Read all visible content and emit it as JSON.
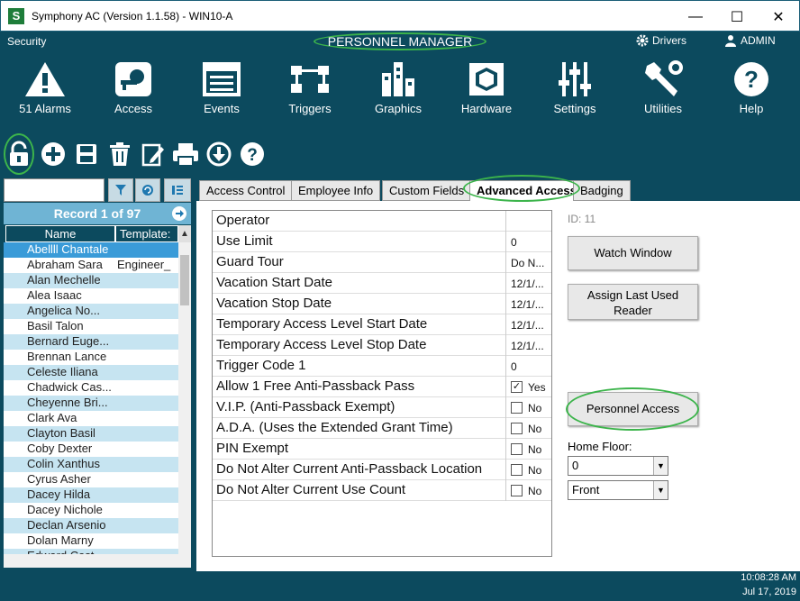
{
  "window": {
    "title": "Symphony AC  (Version 1.1.58) - WIN10-A",
    "logo_letter": "S",
    "minimize": "—",
    "maximize": "☐",
    "close": "✕"
  },
  "header": {
    "section": "Security",
    "module": "PERSONNEL MANAGER",
    "drivers": "Drivers",
    "user": "ADMIN"
  },
  "nav": [
    {
      "label": "51 Alarms",
      "icon": "alarm-icon"
    },
    {
      "label": "Access",
      "icon": "access-icon"
    },
    {
      "label": "Events",
      "icon": "events-icon"
    },
    {
      "label": "Triggers",
      "icon": "triggers-icon"
    },
    {
      "label": "Graphics",
      "icon": "graphics-icon"
    },
    {
      "label": "Hardware",
      "icon": "hardware-icon"
    },
    {
      "label": "Settings",
      "icon": "settings-icon"
    },
    {
      "label": "Utilities",
      "icon": "utilities-icon"
    },
    {
      "label": "Help",
      "icon": "help-icon"
    }
  ],
  "list": {
    "search_value": "",
    "record": "Record 1 of 97",
    "col_name": "Name",
    "col_template": "Template:",
    "rows": [
      {
        "name": "Abellll Chantale",
        "template": ""
      },
      {
        "name": "Abraham Sara",
        "template": "Engineer_"
      },
      {
        "name": "Alan Mechelle",
        "template": ""
      },
      {
        "name": "Alea Isaac",
        "template": ""
      },
      {
        "name": "Angelica No...",
        "template": ""
      },
      {
        "name": "Basil Talon",
        "template": ""
      },
      {
        "name": "Bernard Euge...",
        "template": ""
      },
      {
        "name": "Brennan Lance",
        "template": ""
      },
      {
        "name": "Celeste Iliana",
        "template": ""
      },
      {
        "name": "Chadwick Cas...",
        "template": ""
      },
      {
        "name": "Cheyenne Bri...",
        "template": ""
      },
      {
        "name": "Clark Ava",
        "template": ""
      },
      {
        "name": "Clayton Basil",
        "template": ""
      },
      {
        "name": "Coby Dexter",
        "template": ""
      },
      {
        "name": "Colin Xanthus",
        "template": ""
      },
      {
        "name": "Cyrus Asher",
        "template": ""
      },
      {
        "name": "Dacey Hilda",
        "template": ""
      },
      {
        "name": "Dacey Nichole",
        "template": ""
      },
      {
        "name": "Declan Arsenio",
        "template": ""
      },
      {
        "name": "Dolan Marny",
        "template": ""
      },
      {
        "name": "Edward Cast...",
        "template": ""
      }
    ]
  },
  "tabs": [
    "Access Control",
    "Employee Info",
    "Custom Fields",
    "Advanced Access",
    "Badging"
  ],
  "fields": [
    {
      "label": "Operator",
      "value": "",
      "checkbox": false
    },
    {
      "label": "Use Limit",
      "value": "0",
      "checkbox": false
    },
    {
      "label": "Guard Tour",
      "value": "Do N...",
      "checkbox": false
    },
    {
      "label": "Vacation Start Date",
      "value": "12/1/...",
      "checkbox": false
    },
    {
      "label": "Vacation Stop Date",
      "value": "12/1/...",
      "checkbox": false
    },
    {
      "label": "Temporary Access Level Start Date",
      "value": "12/1/...",
      "checkbox": false
    },
    {
      "label": "Temporary Access Level Stop Date",
      "value": "12/1/...",
      "checkbox": false
    },
    {
      "label": "Trigger Code 1",
      "value": "0",
      "checkbox": false
    },
    {
      "label": "Allow 1 Free Anti-Passback Pass",
      "value": "Yes",
      "checkbox": true,
      "checked": true
    },
    {
      "label": "V.I.P. (Anti-Passback Exempt)",
      "value": "No",
      "checkbox": true,
      "checked": false
    },
    {
      "label": "A.D.A. (Uses the Extended Grant Time)",
      "value": "No",
      "checkbox": true,
      "checked": false
    },
    {
      "label": "PIN Exempt",
      "value": "No",
      "checkbox": true,
      "checked": false
    },
    {
      "label": "Do Not Alter Current Anti-Passback Location",
      "value": "No",
      "checkbox": true,
      "checked": false
    },
    {
      "label": "Do Not Alter Current Use Count",
      "value": "No",
      "checkbox": true,
      "checked": false
    }
  ],
  "side": {
    "id_label": "ID:  11",
    "watch_window": "Watch Window",
    "assign_last_1": "Assign Last Used",
    "assign_last_2": "Reader",
    "personnel_access": "Personnel Access",
    "home_floor_label": "Home Floor:",
    "home_floor_value": "0",
    "side_value": "Front"
  },
  "status": {
    "time": "10:08:28 AM",
    "date": "Jul 17, 2019"
  },
  "colors": {
    "bg": "#0c4a5e",
    "accent": "#6fb4d4",
    "highlight": "#3cb44b"
  }
}
